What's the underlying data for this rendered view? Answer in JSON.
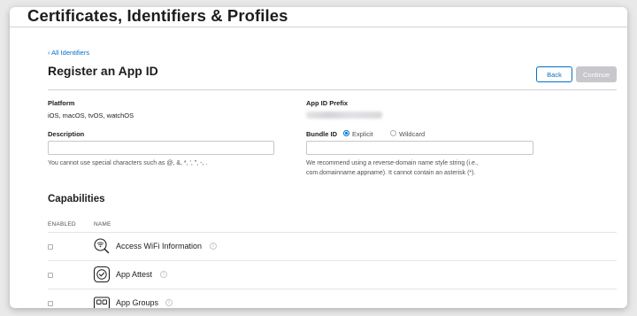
{
  "page": {
    "heading": "Certificates, Identifiers & Profiles",
    "back_link": "‹ All Identifiers",
    "title": "Register an App ID"
  },
  "buttons": {
    "back": "Back",
    "continue": "Continue"
  },
  "platform": {
    "label": "Platform",
    "value": "iOS, macOS, tvOS, watchOS"
  },
  "app_id_prefix": {
    "label": "App ID Prefix"
  },
  "description": {
    "label": "Description",
    "value": "",
    "hint": "You cannot use special characters such as @, &, *, ', \", -, ."
  },
  "bundle_id": {
    "label": "Bundle ID",
    "options": [
      "Explicit",
      "Wildcard"
    ],
    "selected": "Explicit",
    "value": "",
    "hint_line1": "We recommend using a reverse-domain name style string (i.e.,",
    "hint_line2": "com.domainname.appname). It cannot contain an asterisk (*)."
  },
  "capabilities": {
    "title": "Capabilities",
    "columns": [
      "ENABLED",
      "NAME"
    ],
    "items": [
      {
        "name": "Access WiFi Information",
        "icon": "wifi-search-icon",
        "enabled": false
      },
      {
        "name": "App Attest",
        "icon": "app-attest-icon",
        "enabled": false
      },
      {
        "name": "App Groups",
        "icon": "app-groups-icon",
        "enabled": false
      }
    ]
  }
}
